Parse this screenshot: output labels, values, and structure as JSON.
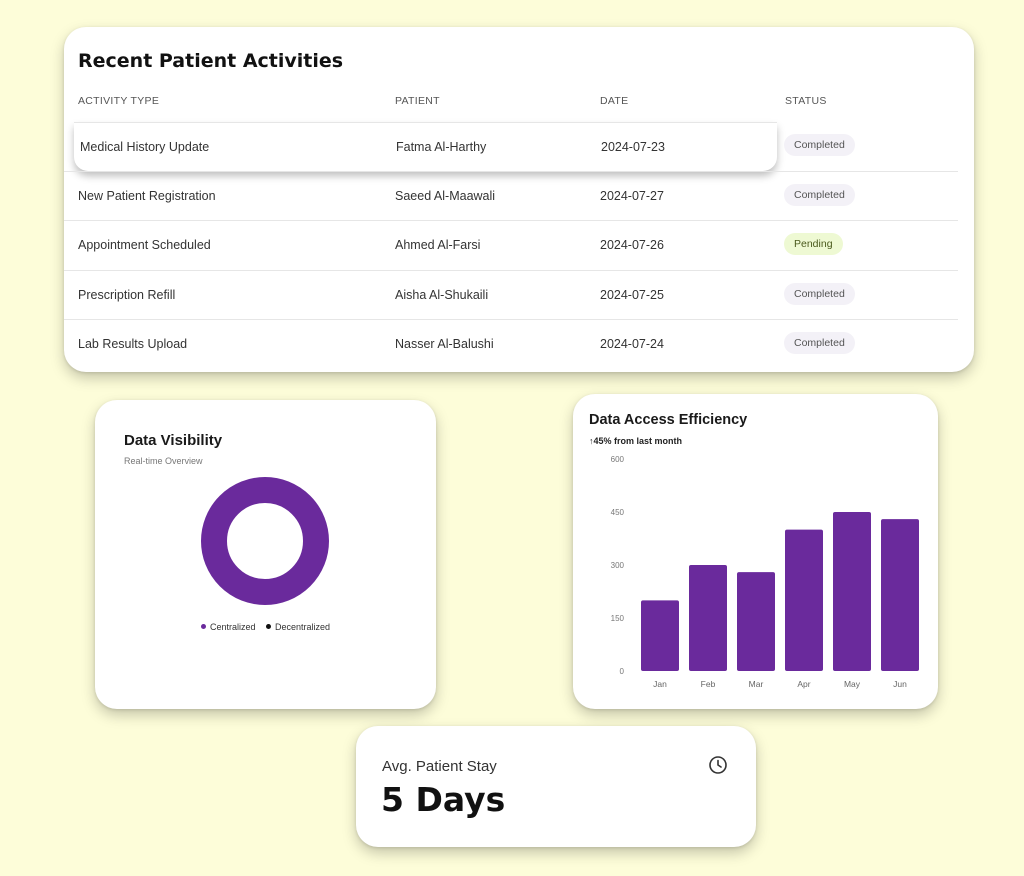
{
  "activities": {
    "title": "Recent Patient Activities",
    "columns": [
      "ACTIVITY TYPE",
      "PATIENT",
      "DATE",
      "STATUS"
    ],
    "rows": [
      {
        "activity": "Medical History Update",
        "patient": "Fatma Al-Harthy",
        "date": "2024-07-23",
        "status": "Completed"
      },
      {
        "activity": "New Patient Registration",
        "patient": "Saeed Al-Maawali",
        "date": "2024-07-27",
        "status": "Completed"
      },
      {
        "activity": "Appointment Scheduled",
        "patient": "Ahmed Al-Farsi",
        "date": "2024-07-26",
        "status": "Pending"
      },
      {
        "activity": "Prescription Refill",
        "patient": "Aisha Al-Shukaili",
        "date": "2024-07-25",
        "status": "Completed"
      },
      {
        "activity": "Lab Results Upload",
        "patient": "Nasser Al-Balushi",
        "date": "2024-07-24",
        "status": "Completed"
      }
    ]
  },
  "visibility": {
    "title": "Data Visibility",
    "subtitle": "Real-time Overview",
    "legend": [
      {
        "label": "Centralized",
        "color": "#6a2a9c"
      },
      {
        "label": "Decentralized",
        "color": "#111111"
      }
    ]
  },
  "efficiency": {
    "title": "Data Access Efficiency",
    "delta": "↑45% from last month"
  },
  "stay": {
    "label": "Avg. Patient Stay",
    "value": "5 Days",
    "icon": "clock-icon"
  },
  "colors": {
    "background": "#fdfdd9",
    "accent": "#6a2a9c",
    "pending_badge": "#eef9d3",
    "completed_badge": "#f3f1f7"
  },
  "chart_data": [
    {
      "type": "pie",
      "title": "Data Visibility",
      "subtitle": "Real-time Overview",
      "slices": [
        {
          "label": "Centralized",
          "value": 100,
          "color": "#6a2a9c"
        },
        {
          "label": "Decentralized",
          "value": 0,
          "color": "#111111"
        }
      ],
      "legend": "bottom"
    },
    {
      "type": "bar",
      "title": "Data Access Efficiency",
      "categories": [
        "Jan",
        "Feb",
        "Mar",
        "Apr",
        "May",
        "Jun"
      ],
      "values": [
        200,
        300,
        280,
        400,
        450,
        430
      ],
      "ylim": [
        0,
        600
      ],
      "yticks": [
        0,
        150,
        300,
        450,
        600
      ],
      "color": "#6a2a9c",
      "grid": false
    }
  ]
}
